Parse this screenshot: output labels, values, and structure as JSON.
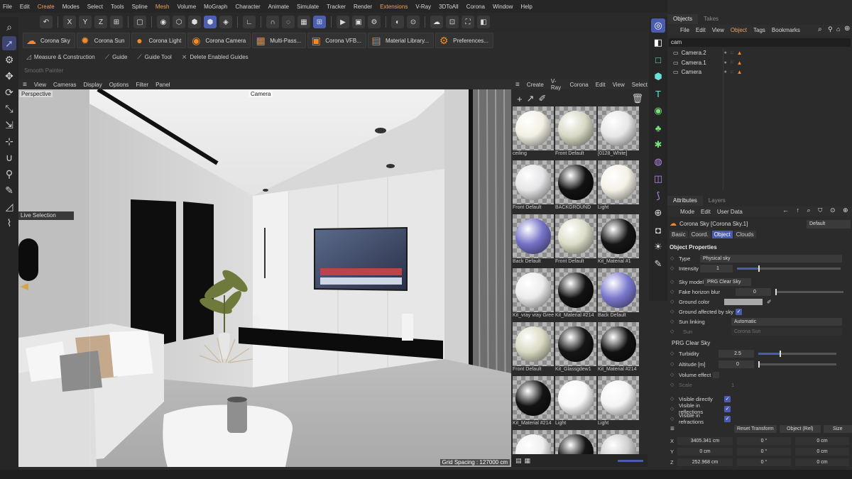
{
  "menu": [
    "File",
    "Edit",
    "Create",
    "Modes",
    "Select",
    "Tools",
    "Spline",
    "Mesh",
    "Volume",
    "MoGraph",
    "Character",
    "Animate",
    "Simulate",
    "Tracker",
    "Render",
    "Extensions",
    "V-Ray",
    "3DToAll",
    "Corona",
    "Window",
    "Help"
  ],
  "axis_buttons": [
    "X",
    "Y",
    "Z"
  ],
  "corona_buttons": [
    "Corona Sky",
    "Corona Sun",
    "Corona Light",
    "Corona Camera",
    "Multi-Pass...",
    "Corona VFB...",
    "Material Library...",
    "Preferences..."
  ],
  "guide_buttons": [
    "Measure & Construction",
    "Guide",
    "Guide Tool",
    "Delete Enabled Guides"
  ],
  "smooth_painter": "Smooth Painter",
  "viewport": {
    "menu": [
      "View",
      "Cameras",
      "Display",
      "Options",
      "Filter",
      "Panel"
    ],
    "label": "Perspective",
    "camera": "Camera",
    "live_selection": "Live Selection",
    "grid_spacing": "Grid Spacing : 127000 cm"
  },
  "materials": {
    "menu": [
      "Create",
      "V-Ray",
      "Corona",
      "Edit",
      "View",
      "Select"
    ],
    "items": [
      {
        "name": "ceiling",
        "color": "#f2f0e4"
      },
      {
        "name": "Front Default",
        "color": "#d7d8c4"
      },
      {
        "name": "[0128_White]",
        "color": "#e7e7e7"
      },
      {
        "name": "Front Default",
        "color": "#e5e5e7"
      },
      {
        "name": "BACKGROUND",
        "color": "#121212"
      },
      {
        "name": "Light",
        "color": "#f4f1e6"
      },
      {
        "name": "Back Default",
        "color": "#7573c7"
      },
      {
        "name": "Front Default",
        "color": "#dcdcc8"
      },
      {
        "name": "Kit_Material #1",
        "color": "#151515"
      },
      {
        "name": "Kit_vray vray Gree",
        "color": "#ececec"
      },
      {
        "name": "Kit_Material #214",
        "color": "#121212"
      },
      {
        "name": "Back Default",
        "color": "#7b79cf"
      },
      {
        "name": "Front Default",
        "color": "#d9d9c3"
      },
      {
        "name": "Kit_Glassgdew1",
        "color": "#151515"
      },
      {
        "name": "Kit_Material #214",
        "color": "#111111"
      },
      {
        "name": "Kit_Material #214",
        "color": "#131313"
      },
      {
        "name": "Light",
        "color": "#f7f7f7"
      },
      {
        "name": "Light",
        "color": "#f4f4f4"
      },
      {
        "name": "",
        "color": "#eeeeee"
      },
      {
        "name": "",
        "color": "#161616"
      },
      {
        "name": "",
        "color": "#cfcfcf"
      }
    ]
  },
  "objects": {
    "tabs": [
      "Objects",
      "Takes"
    ],
    "menu": [
      "File",
      "Edit",
      "View",
      "Object",
      "Tags",
      "Bookmarks"
    ],
    "search": "cam",
    "list": [
      "Camera.2",
      "Camera.1",
      "Camera"
    ]
  },
  "attributes": {
    "tabs": [
      "Attributes",
      "Layers"
    ],
    "menu": [
      "Mode",
      "Edit",
      "User Data"
    ],
    "object_name": "Corona Sky [Corona Sky.1]",
    "mode": "Default",
    "subtabs": [
      "Basic",
      "Coord.",
      "Object",
      "Clouds"
    ],
    "section_title": "Object Properties",
    "type_label": "Type",
    "type_value": "Physical sky",
    "intensity_label": "Intensity",
    "intensity_value": "1",
    "sky_model_label": "Sky model",
    "sky_model_value": "PRG Clear Sky",
    "fake_horizon_label": "Fake horizon blur",
    "fake_horizon_value": "0",
    "ground_color_label": "Ground color",
    "ground_sky_label": "Ground affected by sky",
    "sun_linking_label": "Sun linking",
    "sun_linking_value": "Automatic",
    "sun_label": "Sun",
    "sun_value": "Corona Sun",
    "prg_title": "PRG Clear Sky",
    "turbidity_label": "Turbidity",
    "turbidity_value": "2.5",
    "altitude_label": "Altitude [m]",
    "altitude_value": "0",
    "volume_label": "Volume effect",
    "scale_label": "Scale",
    "scale_value": "1",
    "visible_directly": "Visible directly",
    "visible_reflections": "Visible in reflections",
    "visible_refractions": "Visible in refractions",
    "reset_transform": "Reset Transform",
    "object_rel": "Object (Rel)",
    "size": "Size",
    "coords": [
      {
        "axis": "X",
        "pos": "3405.341 cm",
        "rot": "0 °",
        "size": "0 cm"
      },
      {
        "axis": "Y",
        "pos": "0 cm",
        "rot": "0 °",
        "size": "0 cm"
      },
      {
        "axis": "Z",
        "pos": "252.968 cm",
        "rot": "0 °",
        "size": "0 cm"
      }
    ]
  },
  "colors": {
    "accent": "#4a5bb0",
    "corona_orange": "#f08a2a",
    "teal": "#6be0d8"
  }
}
